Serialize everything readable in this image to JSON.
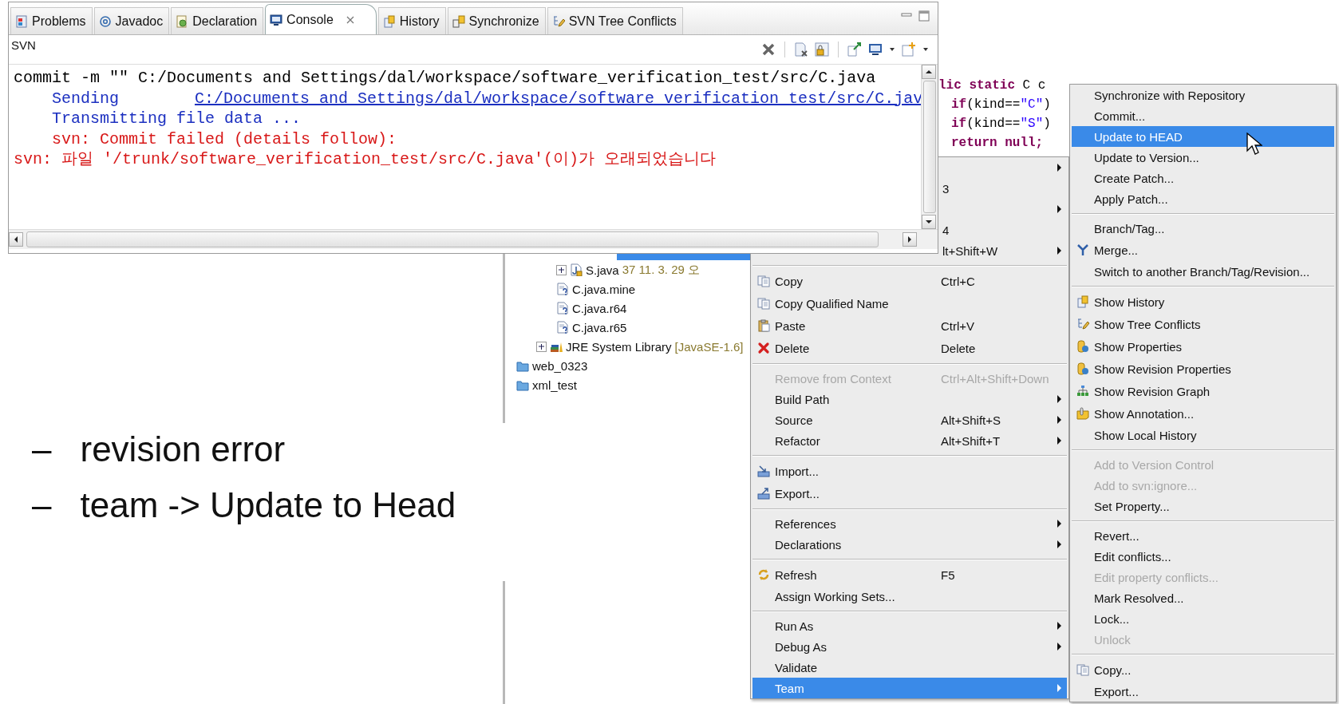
{
  "console": {
    "tabs": [
      {
        "label": "Problems",
        "selected": false
      },
      {
        "label": "Javadoc",
        "selected": false
      },
      {
        "label": "Declaration",
        "selected": false
      },
      {
        "label": "Console",
        "selected": true
      },
      {
        "label": "History",
        "selected": false
      },
      {
        "label": "Synchronize",
        "selected": false
      },
      {
        "label": "SVN Tree Conflicts",
        "selected": false
      }
    ],
    "title": "SVN",
    "lines": [
      {
        "kind": "command",
        "text": "commit -m \"\" C:/Documents and Settings/dal/workspace/software_verification_test/src/C.java"
      },
      {
        "kind": "link",
        "label": "Sending",
        "link": "C:/Documents and Settings/dal/workspace/software_verification_test/src/C.jav"
      },
      {
        "kind": "info",
        "text": "Transmitting file data ..."
      },
      {
        "kind": "error-detail",
        "text": "svn: Commit failed (details follow):"
      },
      {
        "kind": "error",
        "text": "svn: 파일 '/trunk/software_verification_test/src/C.java'(이)가 오래되었습니다"
      }
    ]
  },
  "editor": {
    "lines": [
      {
        "indent": false,
        "tokens": [
          {
            "text": "lic static",
            "kind": "keyword"
          },
          {
            "text": " C c",
            "kind": "plain"
          }
        ]
      },
      {
        "indent": true,
        "tokens": [
          {
            "text": "if",
            "kind": "keyword"
          },
          {
            "text": "(kind==",
            "kind": "plain"
          },
          {
            "text": "\"C\"",
            "kind": "string"
          },
          {
            "text": ")",
            "kind": "plain"
          }
        ]
      },
      {
        "indent": true,
        "tokens": [
          {
            "text": "if",
            "kind": "keyword"
          },
          {
            "text": "(kind==",
            "kind": "plain"
          },
          {
            "text": "\"S\"",
            "kind": "string"
          },
          {
            "text": ")",
            "kind": "plain"
          }
        ]
      },
      {
        "indent": true,
        "tokens": [
          {
            "text": "return null;",
            "kind": "keyword"
          }
        ]
      }
    ]
  },
  "project_tree": {
    "items": [
      {
        "children": [
          {
            "children": [
              {
                "selected": true
              },
              {
                "kind": "java",
                "label": "S.java",
                "detail": "37  11. 3. 29 오",
                "expandable": true,
                "selected": false
              },
              {
                "kind": "unknown",
                "label": "C.java.mine",
                "expandable": false,
                "selected": false
              },
              {
                "kind": "unknown",
                "label": "C.java.r64",
                "expandable": false,
                "selected": false
              },
              {
                "kind": "unknown",
                "label": "C.java.r65",
                "expandable": false,
                "selected": false
              }
            ]
          },
          {
            "kind": "library",
            "label": "JRE System Library",
            "detail": "[JavaSE-1.6]",
            "expandable": true,
            "selected": false
          }
        ]
      },
      {
        "kind": "folder",
        "label": "web_0323",
        "expandable": false,
        "selected": false
      },
      {
        "kind": "folder",
        "label": "xml_test",
        "expandable": false,
        "selected": false
      }
    ]
  },
  "context_menu": {
    "items": [
      {
        "kind": "item",
        "submenu": true,
        "disabled": false,
        "selected": false
      },
      {
        "kind": "item",
        "shortcut": "3",
        "submenu": false,
        "disabled": false,
        "selected": false
      },
      {
        "kind": "item",
        "submenu": true,
        "disabled": false,
        "selected": false
      },
      {
        "kind": "item",
        "shortcut": "4",
        "submenu": false,
        "disabled": false,
        "selected": false
      },
      {
        "kind": "item",
        "shortcut": "lt+Shift+W",
        "submenu": true,
        "disabled": false,
        "selected": false
      },
      {
        "kind": "separator"
      },
      {
        "kind": "item",
        "label": "Copy",
        "shortcut": "Ctrl+C",
        "submenu": false,
        "disabled": false,
        "selected": false
      },
      {
        "kind": "item",
        "label": "Copy Qualified Name",
        "submenu": false,
        "disabled": false,
        "selected": false
      },
      {
        "kind": "item",
        "label": "Paste",
        "shortcut": "Ctrl+V",
        "submenu": false,
        "disabled": false,
        "selected": false
      },
      {
        "kind": "item",
        "label": "Delete",
        "shortcut": "Delete",
        "submenu": false,
        "disabled": false,
        "selected": false
      },
      {
        "kind": "separator"
      },
      {
        "kind": "item",
        "label": "Remove from Context",
        "shortcut": "Ctrl+Alt+Shift+Down",
        "submenu": false,
        "disabled": true,
        "selected": false
      },
      {
        "kind": "item",
        "label": "Build Path",
        "submenu": true,
        "disabled": false,
        "selected": false
      },
      {
        "kind": "item",
        "label": "Source",
        "shortcut": "Alt+Shift+S",
        "submenu": true,
        "disabled": false,
        "selected": false
      },
      {
        "kind": "item",
        "label": "Refactor",
        "shortcut": "Alt+Shift+T",
        "submenu": true,
        "disabled": false,
        "selected": false
      },
      {
        "kind": "separator"
      },
      {
        "kind": "item",
        "label": "Import...",
        "submenu": false,
        "disabled": false,
        "selected": false
      },
      {
        "kind": "item",
        "label": "Export...",
        "submenu": false,
        "disabled": false,
        "selected": false
      },
      {
        "kind": "separator"
      },
      {
        "kind": "item",
        "label": "References",
        "submenu": true,
        "disabled": false,
        "selected": false
      },
      {
        "kind": "item",
        "label": "Declarations",
        "submenu": true,
        "disabled": false,
        "selected": false
      },
      {
        "kind": "separator"
      },
      {
        "kind": "item",
        "label": "Refresh",
        "shortcut": "F5",
        "submenu": false,
        "disabled": false,
        "selected": false
      },
      {
        "kind": "item",
        "label": "Assign Working Sets...",
        "submenu": false,
        "disabled": false,
        "selected": false
      },
      {
        "kind": "separator"
      },
      {
        "kind": "item",
        "label": "Run As",
        "submenu": true,
        "disabled": false,
        "selected": false
      },
      {
        "kind": "item",
        "label": "Debug As",
        "submenu": true,
        "disabled": false,
        "selected": false
      },
      {
        "kind": "item",
        "label": "Validate",
        "submenu": false,
        "disabled": false,
        "selected": false
      },
      {
        "kind": "item",
        "label": "Team",
        "submenu": true,
        "disabled": false,
        "selected": true
      }
    ]
  },
  "team_submenu": {
    "items": [
      {
        "kind": "item",
        "label": "Synchronize with Repository",
        "submenu": false,
        "disabled": false,
        "selected": false
      },
      {
        "kind": "item",
        "label": "Commit...",
        "submenu": false,
        "disabled": false,
        "selected": false
      },
      {
        "kind": "item",
        "label": "Update to HEAD",
        "submenu": false,
        "disabled": false,
        "selected": true
      },
      {
        "kind": "item",
        "label": "Update to Version...",
        "submenu": false,
        "disabled": false,
        "selected": false
      },
      {
        "kind": "item",
        "label": "Create Patch...",
        "submenu": false,
        "disabled": false,
        "selected": false
      },
      {
        "kind": "item",
        "label": "Apply Patch...",
        "submenu": false,
        "disabled": false,
        "selected": false
      },
      {
        "kind": "separator"
      },
      {
        "kind": "item",
        "label": "Branch/Tag...",
        "submenu": false,
        "disabled": false,
        "selected": false
      },
      {
        "kind": "item",
        "label": "Merge...",
        "submenu": false,
        "disabled": false,
        "selected": false
      },
      {
        "kind": "item",
        "label": "Switch to another Branch/Tag/Revision...",
        "submenu": false,
        "disabled": false,
        "selected": false
      },
      {
        "kind": "separator"
      },
      {
        "kind": "item",
        "label": "Show History",
        "submenu": false,
        "disabled": false,
        "selected": false
      },
      {
        "kind": "item",
        "label": "Show Tree Conflicts",
        "submenu": false,
        "disabled": false,
        "selected": false
      },
      {
        "kind": "item",
        "label": "Show Properties",
        "submenu": false,
        "disabled": false,
        "selected": false
      },
      {
        "kind": "item",
        "label": "Show Revision Properties",
        "submenu": false,
        "disabled": false,
        "selected": false
      },
      {
        "kind": "item",
        "label": "Show Revision Graph",
        "submenu": false,
        "disabled": false,
        "selected": false
      },
      {
        "kind": "item",
        "label": "Show Annotation...",
        "submenu": false,
        "disabled": false,
        "selected": false
      },
      {
        "kind": "item",
        "label": "Show Local History",
        "submenu": false,
        "disabled": false,
        "selected": false
      },
      {
        "kind": "separator"
      },
      {
        "kind": "item",
        "label": "Add to Version Control",
        "submenu": false,
        "disabled": true,
        "selected": false
      },
      {
        "kind": "item",
        "label": "Add to svn:ignore...",
        "submenu": false,
        "disabled": true,
        "selected": false
      },
      {
        "kind": "item",
        "label": "Set Property...",
        "submenu": false,
        "disabled": false,
        "selected": false
      },
      {
        "kind": "separator"
      },
      {
        "kind": "item",
        "label": "Revert...",
        "submenu": false,
        "disabled": false,
        "selected": false
      },
      {
        "kind": "item",
        "label": "Edit conflicts...",
        "submenu": false,
        "disabled": false,
        "selected": false
      },
      {
        "kind": "item",
        "label": "Edit property conflicts...",
        "submenu": false,
        "disabled": true,
        "selected": false
      },
      {
        "kind": "item",
        "label": "Mark Resolved...",
        "submenu": false,
        "disabled": false,
        "selected": false
      },
      {
        "kind": "item",
        "label": "Lock...",
        "submenu": false,
        "disabled": false,
        "selected": false
      },
      {
        "kind": "item",
        "label": "Unlock",
        "submenu": false,
        "disabled": true,
        "selected": false
      },
      {
        "kind": "separator"
      },
      {
        "kind": "item",
        "label": "Copy...",
        "submenu": false,
        "disabled": false,
        "selected": false
      },
      {
        "kind": "item",
        "label": "Export...",
        "submenu": false,
        "disabled": false,
        "selected": false
      }
    ]
  },
  "notes": [
    {
      "marker": "–",
      "text": "revision error"
    },
    {
      "marker": "–",
      "text": "team -> Update to Head"
    }
  ]
}
